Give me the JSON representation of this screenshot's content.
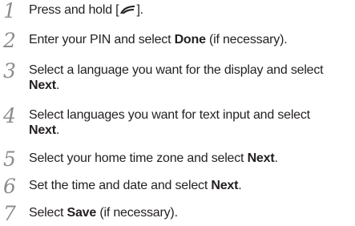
{
  "steps": [
    {
      "number": "1",
      "segments": [
        {
          "text": "Press and hold [",
          "bold": false
        },
        {
          "icon": "power-key-icon"
        },
        {
          "text": "].",
          "bold": false
        }
      ]
    },
    {
      "number": "2",
      "segments": [
        {
          "text": "Enter your PIN and select ",
          "bold": false
        },
        {
          "text": "Done",
          "bold": true
        },
        {
          "text": " (if necessary).",
          "bold": false
        }
      ]
    },
    {
      "number": "3",
      "segments": [
        {
          "text": "Select a language you want for the display and select",
          "bold": false
        },
        {
          "br": true
        },
        {
          "text": "Next",
          "bold": true
        },
        {
          "text": ".",
          "bold": false
        }
      ]
    },
    {
      "number": "4",
      "segments": [
        {
          "text": "Select languages you want for text input and select",
          "bold": false
        },
        {
          "br": true
        },
        {
          "text": "Next",
          "bold": true
        },
        {
          "text": ".",
          "bold": false
        }
      ]
    },
    {
      "number": "5",
      "segments": [
        {
          "text": "Select your home time zone and select ",
          "bold": false
        },
        {
          "text": "Next",
          "bold": true
        },
        {
          "text": ".",
          "bold": false
        }
      ]
    },
    {
      "number": "6",
      "segments": [
        {
          "text": "Set the time and date and select ",
          "bold": false
        },
        {
          "text": "Next",
          "bold": true
        },
        {
          "text": ".",
          "bold": false
        }
      ]
    },
    {
      "number": "7",
      "segments": [
        {
          "text": "Select ",
          "bold": false
        },
        {
          "text": "Save",
          "bold": true
        },
        {
          "text": " (if necessary).",
          "bold": false
        }
      ]
    }
  ]
}
